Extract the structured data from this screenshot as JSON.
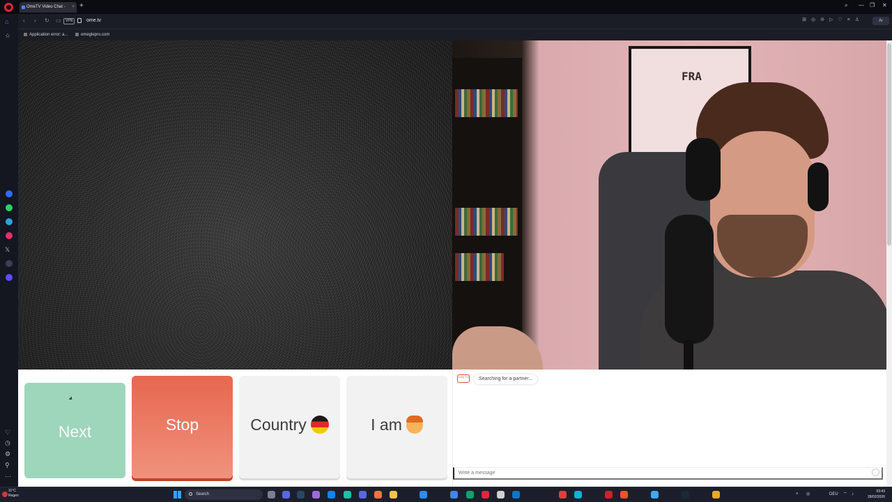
{
  "browser": {
    "tab_title": "OmeTV Video Chat -",
    "tab_close": "×",
    "new_tab": "+",
    "url": "ome.tv",
    "vpn_label": "VPN",
    "ai_label": "Aı",
    "bookmarks": [
      "Application error: a...",
      "omeglepro.com"
    ],
    "window_controls": [
      "—",
      "❐",
      "✕"
    ]
  },
  "main": {
    "buttons": {
      "next": "Next",
      "stop": "Stop",
      "country": "Country",
      "iam": "I am"
    },
    "poster_text": "FRA",
    "chat": {
      "logo": "Ome TV",
      "status_message": "Searching for a partner...",
      "input_placeholder": "Write a message"
    }
  },
  "taskbar": {
    "weather_temp": "11°C",
    "weather_desc": "Regen",
    "search_label": "Search",
    "lang": "DEU",
    "time": "03:43",
    "date": "28/02/2026"
  },
  "colors": {
    "next": "#9ed6bb",
    "stop": "#e7674f",
    "neutral_button": "#f2f2f2",
    "taskbar": "#1c1f2b"
  },
  "icons": [
    "opera-logo-icon",
    "home-icon",
    "star-icon",
    "messenger-icon",
    "whatsapp-icon",
    "telegram-icon",
    "instagram-icon",
    "x-icon",
    "de-flag-icon",
    "person-emoji-icon",
    "windows-start-icon"
  ]
}
